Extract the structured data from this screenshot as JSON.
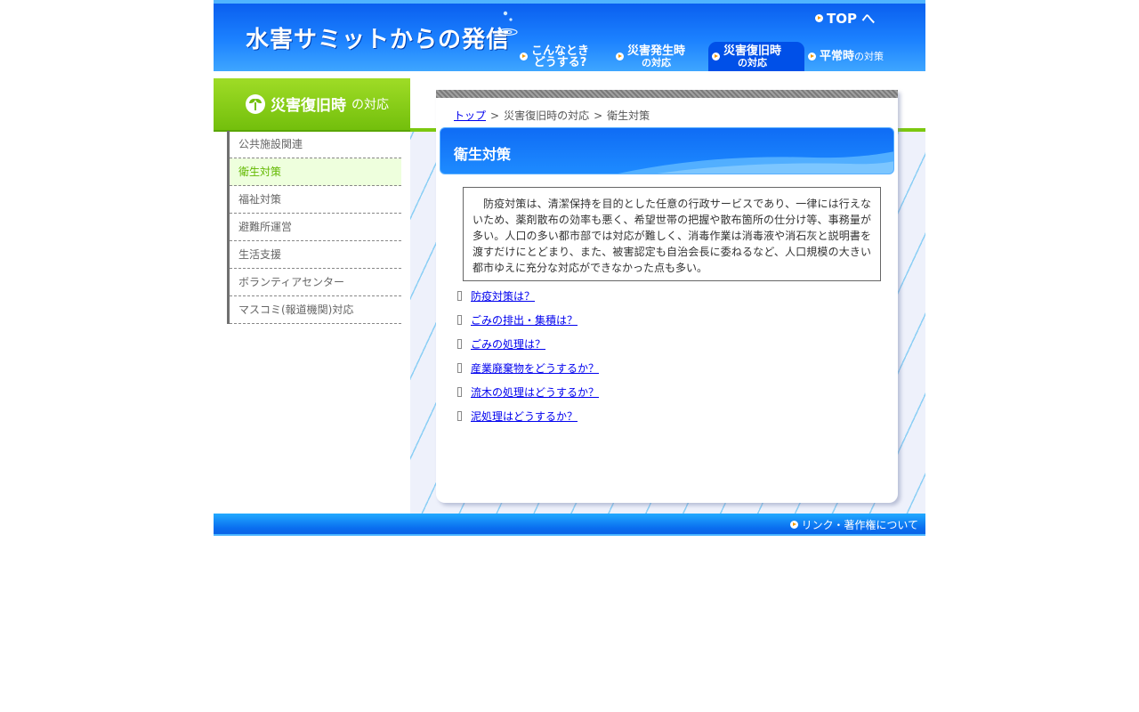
{
  "header": {
    "site_title": "水害サミットからの発信",
    "top_link": "TOP へ",
    "nav": [
      {
        "line1": "こんなとき",
        "line2": "どうする?"
      },
      {
        "line1": "災害発生時",
        "line2": "の対応"
      },
      {
        "line1": "災害復旧時",
        "line2": "の対応"
      },
      {
        "strong": "平常時",
        "small": "の対策"
      }
    ]
  },
  "sidebar": {
    "heading_strong": "災害復旧時",
    "heading_small": "の対応",
    "items": [
      "公共施設関連",
      "衛生対策",
      "福祉対策",
      "避難所運営",
      "生活支援",
      "ボランティアセンター",
      "マスコミ(報道機関)対応"
    ],
    "active_index": 1
  },
  "breadcrumb": {
    "home": "トップ",
    "sep": ">",
    "parent": "災害復旧時の対応",
    "current": "衛生対策"
  },
  "page": {
    "title": "衛生対策",
    "intro": "防疫対策は、清潔保持を目的とした任意の行政サービスであり、一律には行えないため、薬剤散布の効率も悪く、希望世帯の把握や散布箇所の仕分け等、事務量が多い。人口の多い都市部では対応が難しく、消毒作業は消毒液や消石灰と説明書を渡すだけにとどまり、また、被害認定も自治会長に委ねるなど、人口規模の大きい都市ゆえに充分な対応ができなかった点も多い。",
    "links": [
      "防疫対策は？",
      "ごみの排出・集積は？",
      "ごみの処理は？",
      "産業廃棄物をどうするか？",
      "流木の処理はどうするか？",
      "泥処理はどうするか？"
    ]
  },
  "footer": {
    "link": "リンク・著作権について"
  },
  "colors": {
    "header_blue": "#1c82ff",
    "side_green": "#73bf0c",
    "active_green_text": "#62b800",
    "link_blue": "#0000ee"
  }
}
